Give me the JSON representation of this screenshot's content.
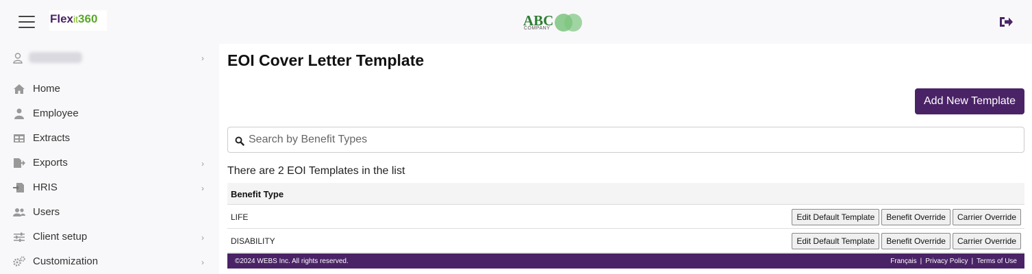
{
  "header": {
    "logo": {
      "part1": "Flex",
      "part2": "it",
      "part3": "360"
    },
    "company_logo": {
      "name": "ABC",
      "sub": "COMPANY"
    }
  },
  "sidebar": {
    "user_name": "",
    "items": [
      {
        "label": "Home",
        "icon": "home-icon",
        "has_submenu": false
      },
      {
        "label": "Employee",
        "icon": "employee-icon",
        "has_submenu": false
      },
      {
        "label": "Extracts",
        "icon": "table-icon",
        "has_submenu": false
      },
      {
        "label": "Exports",
        "icon": "file-export-icon",
        "has_submenu": true
      },
      {
        "label": "HRIS",
        "icon": "file-import-icon",
        "has_submenu": true
      },
      {
        "label": "Users",
        "icon": "users-icon",
        "has_submenu": false
      },
      {
        "label": "Client setup",
        "icon": "sliders-icon",
        "has_submenu": true
      },
      {
        "label": "Customization",
        "icon": "gears-icon",
        "has_submenu": true
      }
    ]
  },
  "main": {
    "title": "EOI Cover Letter Template",
    "add_button": "Add New Template",
    "search_placeholder": "Search by Benefit Types",
    "count_text": "There are 2 EOI Templates in the list",
    "table": {
      "header": "Benefit Type",
      "rows": [
        {
          "benefit_type": "LIFE",
          "actions": [
            "Edit Default Template",
            "Benefit Override",
            "Carrier Override"
          ]
        },
        {
          "benefit_type": "DISABILITY",
          "actions": [
            "Edit Default Template",
            "Benefit Override",
            "Carrier Override"
          ]
        }
      ]
    }
  },
  "footer": {
    "copyright": "©2024 WEBS Inc. All rights reserved.",
    "links": [
      "Français",
      "Privacy Policy",
      "Terms of Use"
    ],
    "separator": "|"
  },
  "colors": {
    "brand": "#4a2366",
    "accent": "#7cb518"
  }
}
